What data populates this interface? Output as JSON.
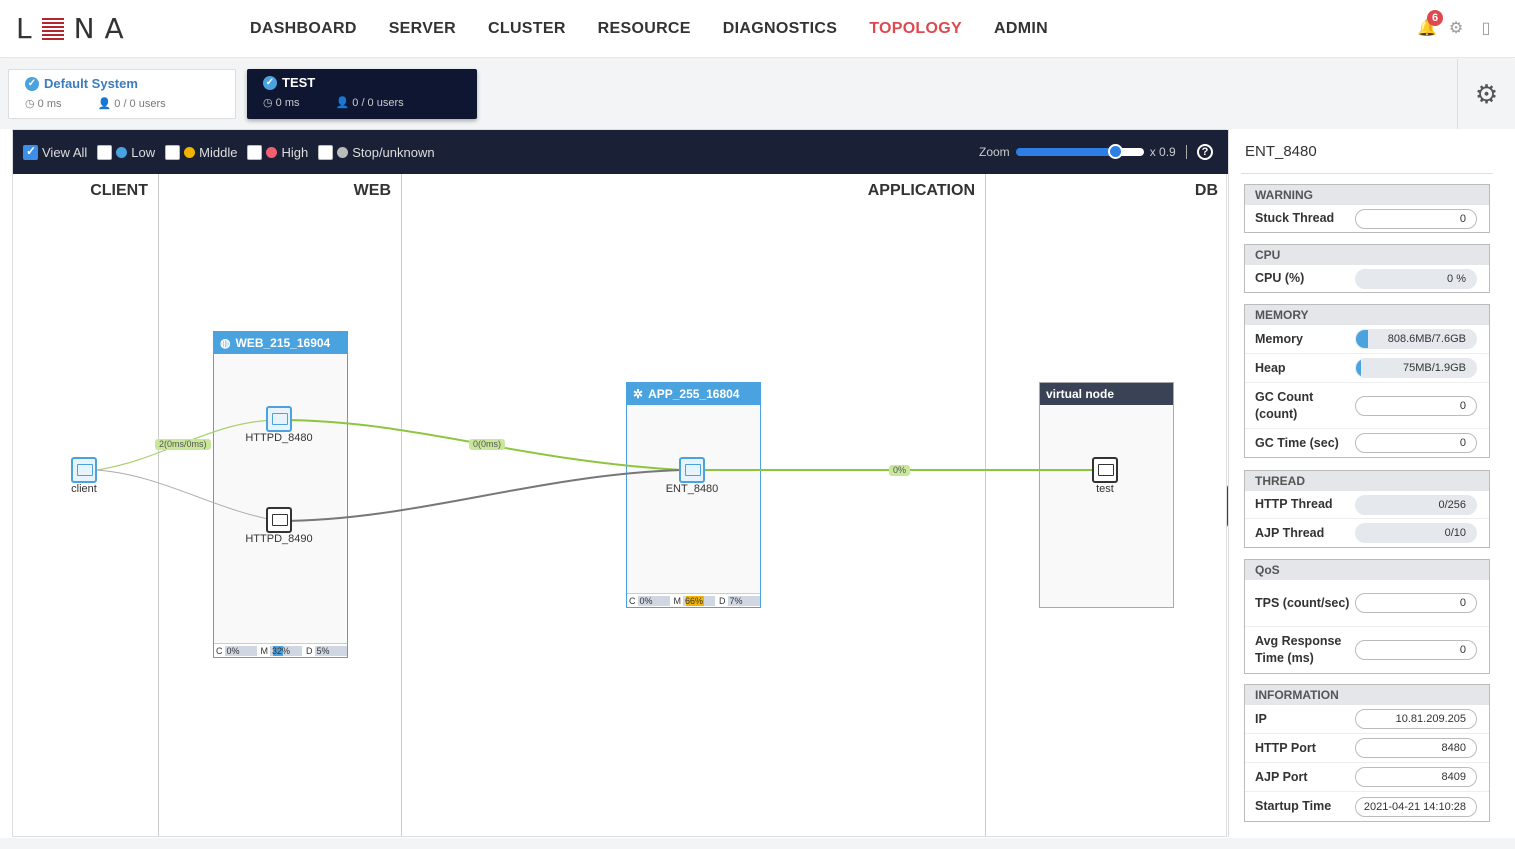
{
  "header": {
    "logo": "LENA",
    "nav": [
      "DASHBOARD",
      "SERVER",
      "CLUSTER",
      "RESOURCE",
      "DIAGNOSTICS",
      "TOPOLOGY",
      "ADMIN"
    ],
    "active_nav": "TOPOLOGY",
    "notifications": "6"
  },
  "systems": [
    {
      "name": "Default System",
      "time": "0 ms",
      "users": "0 / 0 users"
    },
    {
      "name": "TEST",
      "time": "0 ms",
      "users": "0 / 0 users"
    }
  ],
  "toolbar": {
    "view_all": "View All",
    "low": "Low",
    "middle": "Middle",
    "high": "High",
    "stop": "Stop/unknown",
    "zoom_label": "Zoom",
    "zoom_value": "x 0.9",
    "zoom_level": 0.9,
    "colors": {
      "low": "#4aa3df",
      "middle": "#f0b400",
      "high": "#f06070",
      "stop": "#bbbbbb"
    }
  },
  "columns": [
    "CLIENT",
    "WEB",
    "APPLICATION",
    "DB"
  ],
  "groups": {
    "web": {
      "title": "WEB_215_16904",
      "c": "0%",
      "m": "32%",
      "d": "5%"
    },
    "app": {
      "title": "APP_255_16804",
      "c": "0%",
      "m": "66%",
      "d": "7%"
    },
    "virtual": {
      "title": "virtual node"
    }
  },
  "nodes": {
    "client": "client",
    "httpd1": "HTTPD_8480",
    "httpd2": "HTTPD_8490",
    "ent": "ENT_8480",
    "test": "test"
  },
  "edges": {
    "e1": "2(0ms/0ms)",
    "e2": "0(0ms)",
    "e3": "0%"
  },
  "panel": {
    "title": "ENT_8480",
    "warning": {
      "title": "WARNING",
      "stuck_label": "Stuck Thread",
      "stuck": "0"
    },
    "cpu": {
      "title": "CPU",
      "cpu_label": "CPU (%)",
      "cpu": "0 %"
    },
    "memory": {
      "title": "MEMORY",
      "mem_label": "Memory",
      "mem": "808.6MB/7.6GB",
      "mem_ratio": 0.104,
      "heap_label": "Heap",
      "heap": "75MB/1.9GB",
      "heap_ratio": 0.039,
      "gcc_label": "GC Count (count)",
      "gcc": "0",
      "gct_label": "GC Time (sec)",
      "gct": "0"
    },
    "thread": {
      "title": "THREAD",
      "http_label": "HTTP Thread",
      "http": "0/256",
      "ajp_label": "AJP Thread",
      "ajp": "0/10"
    },
    "qos": {
      "title": "QoS",
      "tps_label": "TPS (count/sec)",
      "tps": "0",
      "avg_label": "Avg Response Time (ms)",
      "avg": "0"
    },
    "info": {
      "title": "INFORMATION",
      "ip_label": "IP",
      "ip": "10.81.209.205",
      "http_port_label": "HTTP Port",
      "http_port": "8480",
      "ajp_port_label": "AJP Port",
      "ajp_port": "8409",
      "startup_label": "Startup Time",
      "startup": "2021-04-21 14:10:28"
    }
  }
}
